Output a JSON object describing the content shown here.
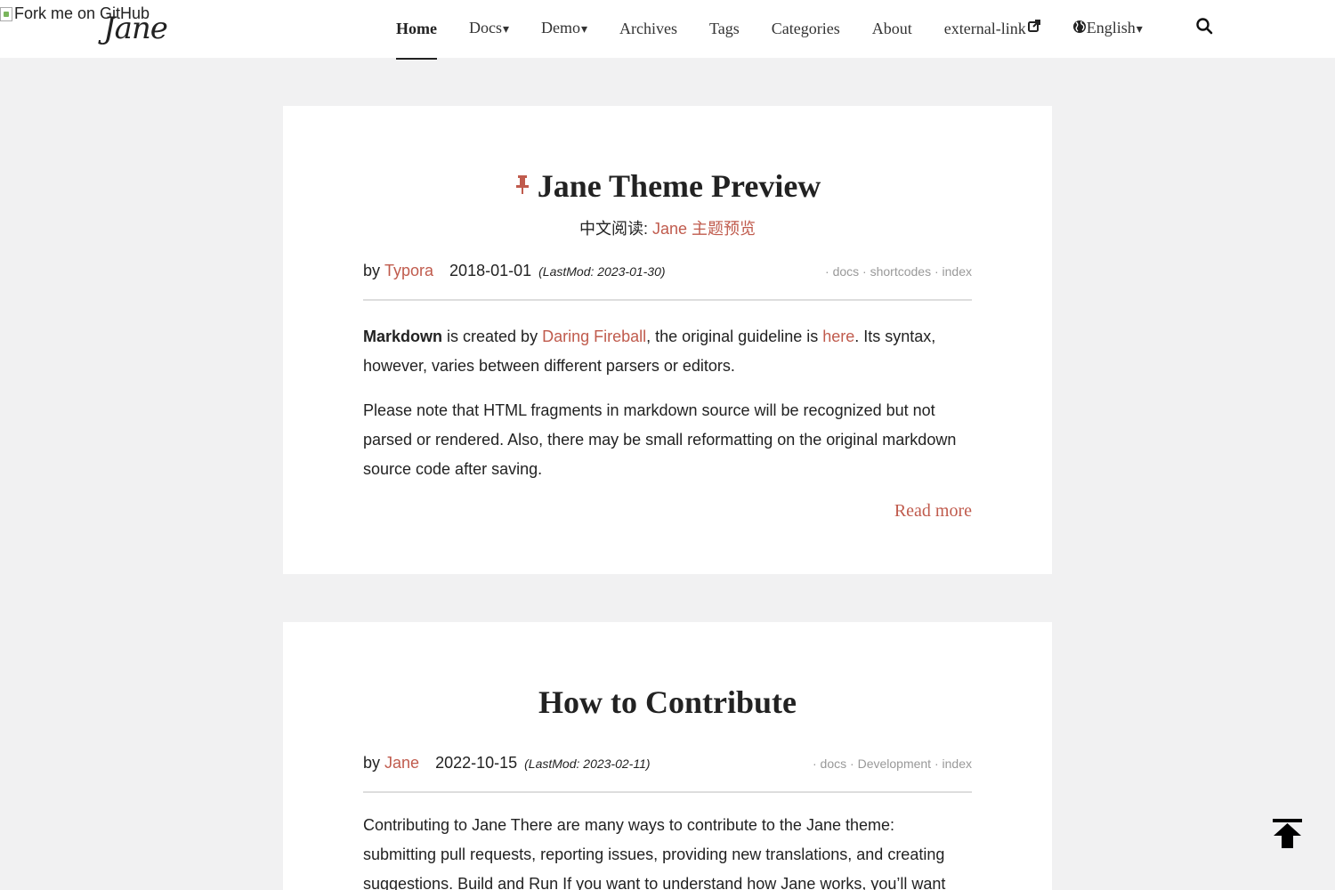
{
  "header": {
    "fork_alt": "Fork me on GitHub",
    "logo": "Jane",
    "nav": [
      {
        "label": "Home",
        "active": true
      },
      {
        "label": "Docs",
        "dropdown": true
      },
      {
        "label": "Demo",
        "dropdown": true
      },
      {
        "label": "Archives"
      },
      {
        "label": "Tags"
      },
      {
        "label": "Categories"
      },
      {
        "label": "About"
      },
      {
        "label": "external-link",
        "icon": "external-link-icon"
      },
      {
        "label": "English",
        "icon": "globe-icon",
        "dropdown": true
      }
    ],
    "caret": "▾"
  },
  "posts": [
    {
      "pinned": true,
      "title": "Jane Theme Preview",
      "subtitle_prefix": "中文阅读: ",
      "subtitle_link": "Jane 主题预览",
      "by": "by",
      "author": "Typora",
      "date": "2018-01-01",
      "lastmod": "(LastMod: 2023-01-30)",
      "categories": [
        "docs",
        "shortcodes",
        "index"
      ],
      "para1": {
        "bold": "Markdown",
        "t1": " is created by ",
        "link1": "Daring Fireball",
        "t2": ", the original guideline is ",
        "link2": "here",
        "t3": ". Its syntax, however, varies between different parsers or editors."
      },
      "para2": "Please note that HTML fragments in markdown source will be recognized but not parsed or rendered. Also, there may be small reformatting on the original markdown source code after saving.",
      "read_more": "Read more"
    },
    {
      "pinned": false,
      "title": "How to Contribute",
      "by": "by",
      "author": "Jane",
      "date": "2022-10-15",
      "lastmod": "(LastMod: 2023-02-11)",
      "categories": [
        "docs",
        "Development",
        "index"
      ],
      "para1": "Contributing to Jane There are many ways to contribute to the Jane theme: submitting pull requests, reporting issues, providing new translations, and creating suggestions. Build and Run If you want to understand how Jane works, you’ll want"
    }
  ],
  "colors": {
    "accent": "#c05b4d",
    "background": "#f1f1f2",
    "card": "#ffffff"
  },
  "icons": [
    "pin-icon",
    "external-link-icon",
    "globe-icon",
    "search-icon",
    "back-to-top-icon"
  ]
}
